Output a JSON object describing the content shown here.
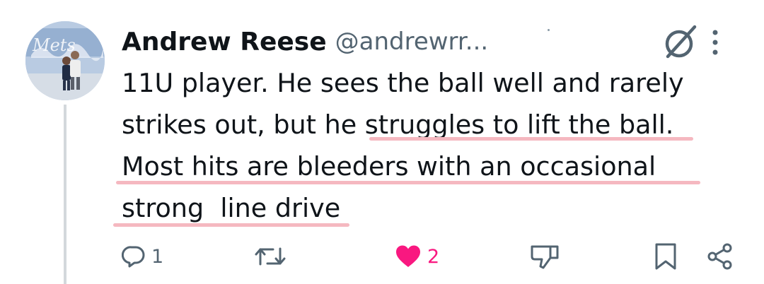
{
  "author": {
    "display_name": "Andrew Reese",
    "handle": "@andrewrr..."
  },
  "tweet": {
    "lines": [
      "11U player. He sees the ball well and rarely",
      "strikes out, but he struggles to lift the ball.",
      "Most hits are bleeders with an occasional",
      "strong  line drive"
    ]
  },
  "actions": {
    "reply_count": "1",
    "like_count": "2",
    "liked": true
  },
  "icons": {
    "header": [
      "grok-icon",
      "more-vertical-icon"
    ],
    "actions": [
      "reply-icon",
      "retweet-icon",
      "heart-icon",
      "dislike-icon",
      "bookmark-icon",
      "share-icon"
    ]
  },
  "colors": {
    "text": "#0f1419",
    "secondary": "#536471",
    "like": "#f91880",
    "highlight_underline": "#f5b8c0"
  }
}
